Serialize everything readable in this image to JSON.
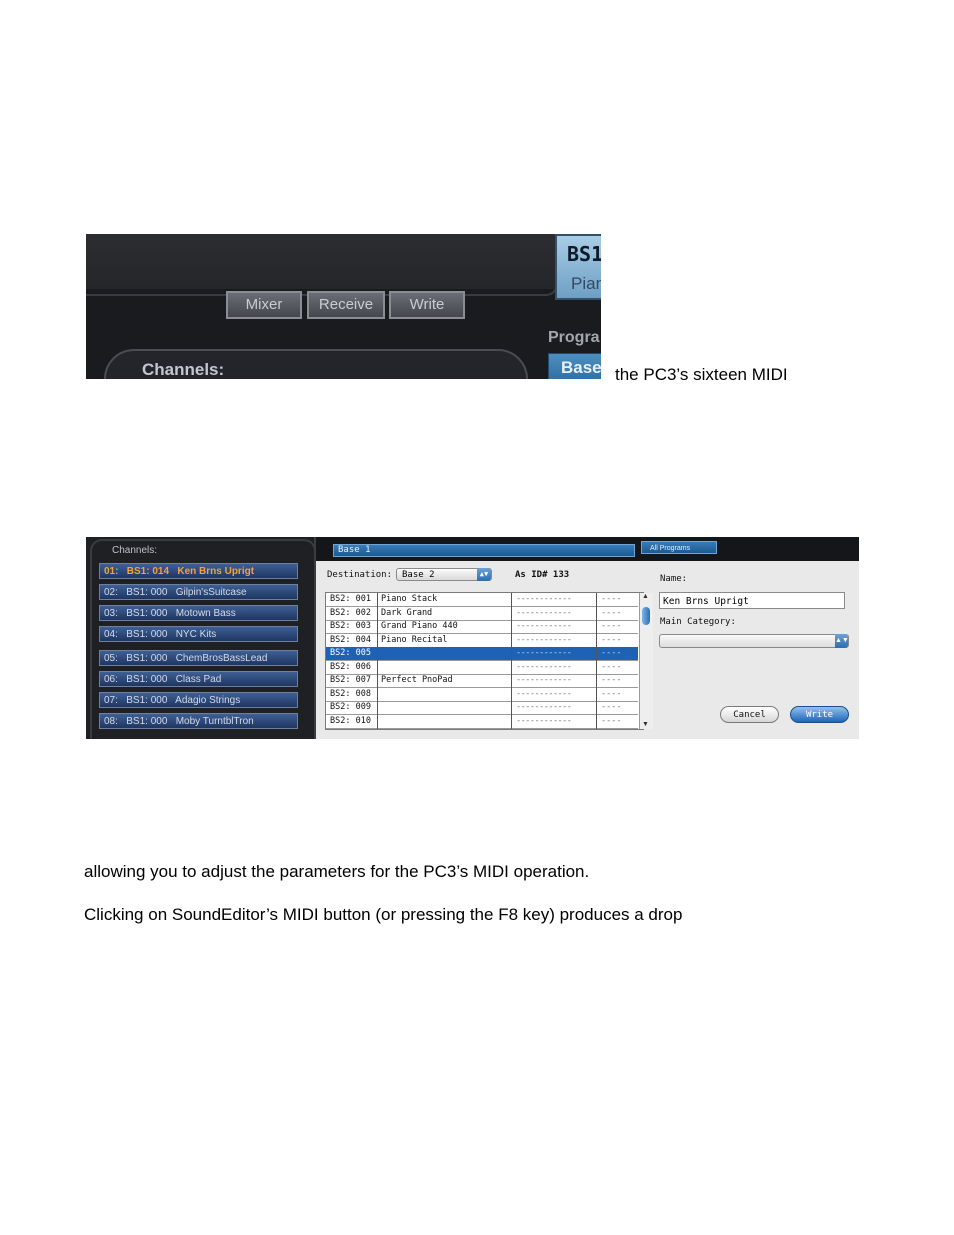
{
  "paragraphs": {
    "line1_tail": "the PC3’s sixteen MIDI",
    "line2": "allowing you to adjust the parameters for the PC3’s MIDI operation.",
    "line3": "Clicking on SoundEditor’s MIDI button (or pressing the F8 key) produces a drop"
  },
  "screenshot1": {
    "buttons": [
      "Mixer",
      "Receive",
      "Write"
    ],
    "channels_label": "Channels:",
    "program_box_top": "BS1",
    "program_box_bottom": "Pian",
    "program_label": "Progra",
    "base_label": "Base"
  },
  "screenshot2": {
    "channels_label": "Channels:",
    "channels": [
      "01:   BS1: 014   Ken Brns Uprigt",
      "02:   BS1: 000   Gilpin'sSuitcase",
      "03:   BS1: 000   Motown Bass",
      "04:   BS1: 000   NYC Kits",
      "05:   BS1: 000   ChemBrosBassLead",
      "06:   BS1: 000   Class Pad",
      "07:   BS1: 000   Adagio Strings",
      "08:   BS1: 000   Moby TurntblTron"
    ],
    "base_tab": "Base 1",
    "all_programs_tab": "All Programs",
    "destination_label": "Destination:",
    "destination_value": "Base 2",
    "as_id": "As ID# 133",
    "list_rows": [
      {
        "id": "BS2: 001",
        "name": "Piano Stack",
        "dash1": "------------",
        "dash2": "----"
      },
      {
        "id": "BS2: 002",
        "name": "Dark Grand",
        "dash1": "------------",
        "dash2": "----"
      },
      {
        "id": "BS2: 003",
        "name": "Grand Piano 440",
        "dash1": "------------",
        "dash2": "----"
      },
      {
        "id": "BS2: 004",
        "name": "Piano Recital",
        "dash1": "------------",
        "dash2": "----"
      },
      {
        "id": "BS2: 005",
        "name": "",
        "dash1": "------------",
        "dash2": "----"
      },
      {
        "id": "BS2: 006",
        "name": "",
        "dash1": "------------",
        "dash2": "----"
      },
      {
        "id": "BS2: 007",
        "name": "Perfect PnoPad",
        "dash1": "------------",
        "dash2": "----"
      },
      {
        "id": "BS2: 008",
        "name": "",
        "dash1": "------------",
        "dash2": "----"
      },
      {
        "id": "BS2: 009",
        "name": "",
        "dash1": "------------",
        "dash2": "----"
      },
      {
        "id": "BS2: 010",
        "name": "",
        "dash1": "------------",
        "dash2": "----"
      }
    ],
    "selected_row_index": 4,
    "name_label": "Name:",
    "name_value": "Ken Brns Uprigt",
    "main_category_label": "Main Category:",
    "main_category_value": "",
    "cancel_label": "Cancel",
    "write_label": "Write"
  }
}
